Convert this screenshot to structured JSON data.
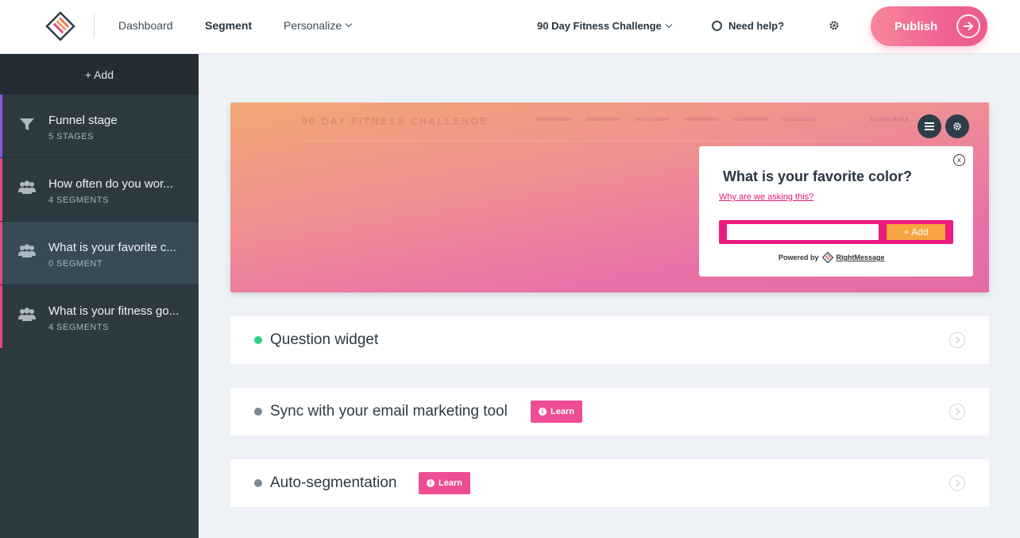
{
  "header": {
    "nav": {
      "dashboard": "Dashboard",
      "segment": "Segment",
      "personalize": "Personalize"
    },
    "project": "90 Day Fitness Challenge",
    "help": "Need help?",
    "publish": "Publish"
  },
  "sidebar": {
    "add": "+ Add",
    "items": [
      {
        "title": "Funnel stage",
        "subtitle": "5 STAGES",
        "icon": "funnel-icon",
        "accent": "#8a56e2"
      },
      {
        "title": "How often do you wor...",
        "subtitle": "4 SEGMENTS",
        "icon": "users-icon",
        "accent": "#e8477f"
      },
      {
        "title": "What is your favorite c...",
        "subtitle": "0 SEGMENT",
        "icon": "users-icon",
        "accent": "#e8477f"
      },
      {
        "title": "What is your fitness go...",
        "subtitle": "4 SEGMENTS",
        "icon": "users-icon",
        "accent": "#e8477f"
      }
    ]
  },
  "preview": {
    "site_title": "90 DAY FITNESS CHALLENGE",
    "site_nav_last": "SUBSCRIBE",
    "popup": {
      "question": "What is your favorite color?",
      "why": "Why are we asking this?",
      "input_value": "",
      "add": "+ Add",
      "close": "x",
      "powered_by": "Powered by",
      "brand": "RightMessage"
    }
  },
  "cards": [
    {
      "title": "Question widget",
      "status": "active",
      "learn": ""
    },
    {
      "title": "Sync with your email marketing tool",
      "status": "inactive",
      "learn": "Learn"
    },
    {
      "title": "Auto-segmentation",
      "status": "inactive",
      "learn": "Learn"
    }
  ],
  "colors": {
    "accent_pink": "#ef4d93",
    "publish_gradient_start": "#f6889a",
    "sidebar_bg": "#2e3a42",
    "active_green": "#2fcf82"
  }
}
